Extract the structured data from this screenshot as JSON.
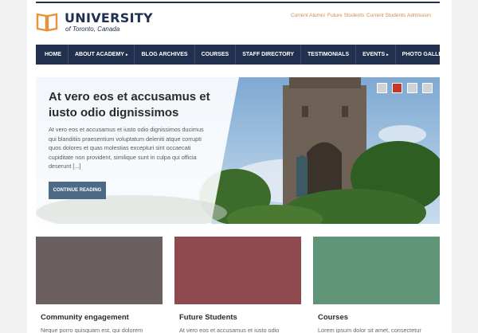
{
  "header": {
    "brand_name": "UNIVERSITY",
    "brand_sub": "of Toronto, Canada",
    "logo_icon": "open-book-icon",
    "accent_color": "#e8933c",
    "top_links": [
      "Current Alumni",
      "Future Students",
      "Current Students",
      "Admission"
    ]
  },
  "nav": {
    "items": [
      {
        "label": "HOME",
        "caret": ""
      },
      {
        "label": "ABOUT ACADEMY",
        "caret": "▸"
      },
      {
        "label": "BLOG ARCHIVES",
        "caret": ""
      },
      {
        "label": "COURSES",
        "caret": ""
      },
      {
        "label": "STAFF DIRECTORY",
        "caret": ""
      },
      {
        "label": "TESTIMONIALS",
        "caret": ""
      },
      {
        "label": "EVENTS",
        "caret": "▸"
      },
      {
        "label": "PHOTO GALLERY",
        "caret": ""
      }
    ]
  },
  "hero": {
    "title": "At vero eos et accusamus et iusto odio dignissimos",
    "text": "At vero eos et accusamus et iusto odio dignissimos ducimus qui blanditiis praesentium voluptatum deleniti atque corrupti quos dolores et quas molestias excepturi sint occaecati cupiditate non provident, similique sunt in culpa qui officia deserunt [...]",
    "button_label": "CONTINUE READING",
    "active_slide": 2
  },
  "cards": [
    {
      "title": "Community engagement",
      "text": "Neque porro quisquam est, qui dolorem",
      "color": "#6b5f5f"
    },
    {
      "title": "Future Students",
      "text": "At vero eos et accusamus et iusto odio",
      "color": "#8e4a4f"
    },
    {
      "title": "Courses",
      "text": "Lorem ipsum dolor sit amet, consectetur",
      "color": "#5f9576"
    }
  ]
}
